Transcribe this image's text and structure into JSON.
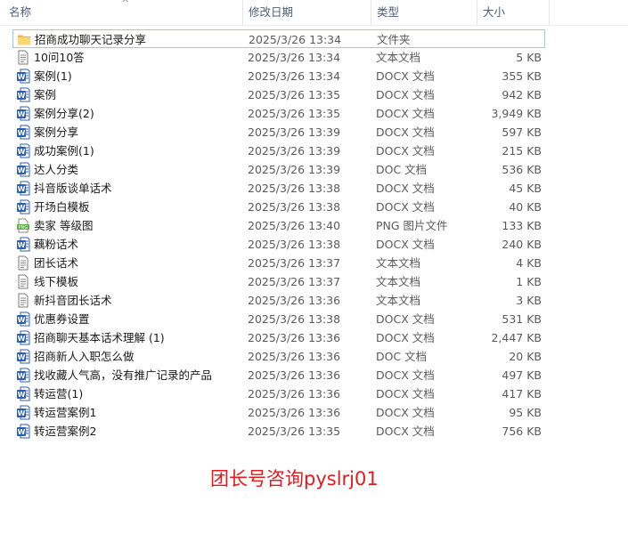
{
  "columns": {
    "name": "名称",
    "date": "修改日期",
    "type": "类型",
    "size": "大小"
  },
  "files": [
    {
      "name": "招商成功聊天记录分享",
      "date": "2025/3/26 13:34",
      "type": "文件夹",
      "size": "",
      "icon": "folder-icon"
    },
    {
      "name": "10问10答",
      "date": "2025/3/26 13:34",
      "type": "文本文档",
      "size": "5 KB",
      "icon": "text-file-icon"
    },
    {
      "name": "案例(1)",
      "date": "2025/3/26 13:34",
      "type": "DOCX 文档",
      "size": "355 KB",
      "icon": "word-docx-icon"
    },
    {
      "name": "案例",
      "date": "2025/3/26 13:35",
      "type": "DOCX 文档",
      "size": "942 KB",
      "icon": "word-docx-icon"
    },
    {
      "name": "案例分享(2)",
      "date": "2025/3/26 13:35",
      "type": "DOCX 文档",
      "size": "3,949 KB",
      "icon": "word-docx-icon"
    },
    {
      "name": "案例分享",
      "date": "2025/3/26 13:39",
      "type": "DOCX 文档",
      "size": "597 KB",
      "icon": "word-docx-icon"
    },
    {
      "name": "成功案例(1)",
      "date": "2025/3/26 13:39",
      "type": "DOCX 文档",
      "size": "215 KB",
      "icon": "word-docx-icon"
    },
    {
      "name": "达人分类",
      "date": "2025/3/26 13:39",
      "type": "DOC 文档",
      "size": "536 KB",
      "icon": "word-doc-icon"
    },
    {
      "name": "抖音版谈单话术",
      "date": "2025/3/26 13:38",
      "type": "DOCX 文档",
      "size": "45 KB",
      "icon": "word-docx-icon"
    },
    {
      "name": "开场白模板",
      "date": "2025/3/26 13:38",
      "type": "DOCX 文档",
      "size": "40 KB",
      "icon": "word-docx-icon"
    },
    {
      "name": "卖家 等级图",
      "date": "2025/3/26 13:40",
      "type": "PNG 图片文件",
      "size": "133 KB",
      "icon": "png-image-icon"
    },
    {
      "name": "藕粉话术",
      "date": "2025/3/26 13:38",
      "type": "DOCX 文档",
      "size": "240 KB",
      "icon": "word-docx-icon"
    },
    {
      "name": "团长话术",
      "date": "2025/3/26 13:37",
      "type": "文本文档",
      "size": "4 KB",
      "icon": "text-file-icon"
    },
    {
      "name": "线下模板",
      "date": "2025/3/26 13:37",
      "type": "文本文档",
      "size": "1 KB",
      "icon": "text-file-icon"
    },
    {
      "name": "新抖音团长话术",
      "date": "2025/3/26 13:36",
      "type": "文本文档",
      "size": "3 KB",
      "icon": "text-file-icon"
    },
    {
      "name": "优惠券设置",
      "date": "2025/3/26 13:38",
      "type": "DOCX 文档",
      "size": "531 KB",
      "icon": "word-docx-icon"
    },
    {
      "name": "招商聊天基本话术理解 (1)",
      "date": "2025/3/26 13:36",
      "type": "DOCX 文档",
      "size": "2,447 KB",
      "icon": "word-docx-icon"
    },
    {
      "name": "招商新人入职怎么做",
      "date": "2025/3/26 13:36",
      "type": "DOC 文档",
      "size": "20 KB",
      "icon": "word-doc-icon"
    },
    {
      "name": "找收藏人气高，没有推广记录的产品",
      "date": "2025/3/26 13:36",
      "type": "DOCX 文档",
      "size": "497 KB",
      "icon": "word-docx-icon"
    },
    {
      "name": "转运营(1)",
      "date": "2025/3/26 13:36",
      "type": "DOCX 文档",
      "size": "417 KB",
      "icon": "word-docx-icon"
    },
    {
      "name": "转运营案例1",
      "date": "2025/3/26 13:36",
      "type": "DOCX 文档",
      "size": "95 KB",
      "icon": "word-docx-icon"
    },
    {
      "name": "转运营案例2",
      "date": "2025/3/26 13:35",
      "type": "DOCX 文档",
      "size": "756 KB",
      "icon": "word-docx-icon"
    }
  ],
  "footer": {
    "text": "团长号咨询pyslrj01",
    "color": "#e8191a"
  },
  "colors": {
    "selection_border": "#99c9ef",
    "word_blue": "#2b5fb4",
    "folder_yellow": "#f8d775",
    "header_text": "#4c607a"
  }
}
